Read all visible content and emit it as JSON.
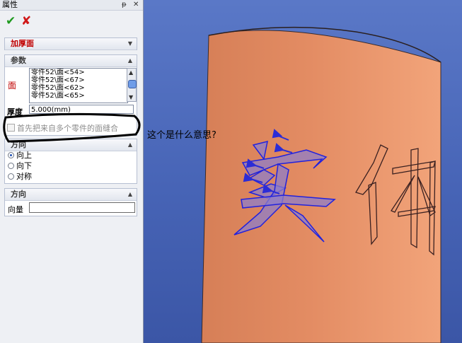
{
  "panel": {
    "title": "属性",
    "pin_glyph": "ᵽ",
    "close_glyph": "✕",
    "ok_glyph": "✔",
    "cancel_glyph": "✘",
    "thicken_group": {
      "label": "加厚面"
    },
    "params_group": {
      "label": "参数",
      "face_label": "面",
      "faces": [
        "零件52\\面<54>",
        "零件52\\面<67>",
        "零件52\\面<62>",
        "零件52\\面<65>"
      ],
      "thickness_label": "厚度",
      "thickness_value": "5.000(mm)",
      "stitch_checkbox": "首先把来自多个零件的面缝合",
      "stitch_checked": false
    },
    "direction_group": {
      "label": "方向",
      "options": [
        "向上",
        "向下",
        "对称"
      ],
      "selected_index": 0
    },
    "direction_group2": {
      "label": "方向",
      "vector_label": "向量",
      "vector_value": ""
    }
  },
  "viewport": {
    "question_text": "这个是什么意思?",
    "text_chars": [
      "实",
      "体"
    ],
    "colors": {
      "background": "#4a68b8",
      "cylinder": "#e79065",
      "selection": "#2c2cd6",
      "annotation": "#000000"
    }
  }
}
